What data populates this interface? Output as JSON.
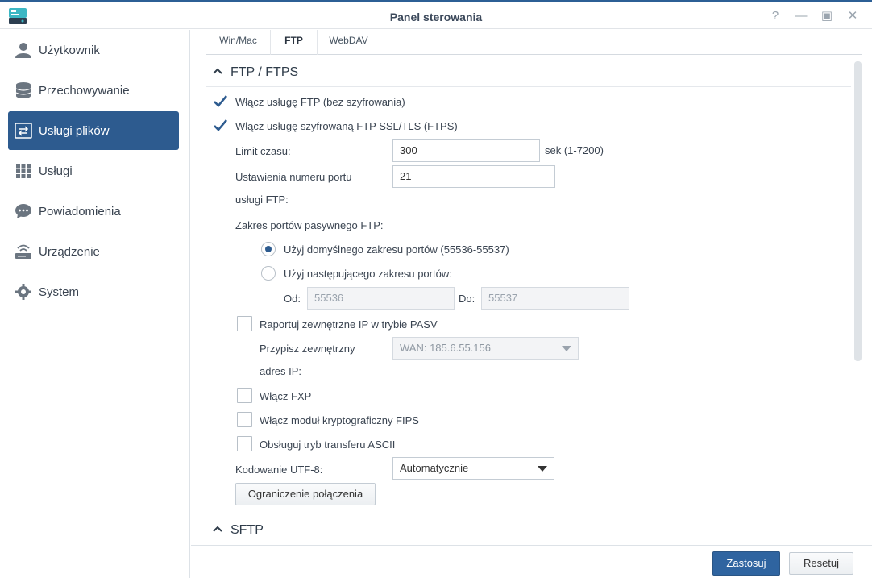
{
  "window": {
    "title": "Panel sterowania",
    "help_glyph": "?",
    "minimize_glyph": "—",
    "maximize_glyph": "▣",
    "close_glyph": "✕"
  },
  "sidebar": {
    "items": [
      {
        "label": "Użytkownik",
        "icon": "user-icon",
        "active": false
      },
      {
        "label": "Przechowywanie",
        "icon": "storage-icon",
        "active": false
      },
      {
        "label": "Usługi plików",
        "icon": "file-services-icon",
        "active": true
      },
      {
        "label": "Usługi",
        "icon": "grid-icon",
        "active": false
      },
      {
        "label": "Powiadomienia",
        "icon": "chat-icon",
        "active": false
      },
      {
        "label": "Urządzenie",
        "icon": "router-icon",
        "active": false
      },
      {
        "label": "System",
        "icon": "gear-icon",
        "active": false
      }
    ]
  },
  "tabs": [
    {
      "label": "Win/Mac",
      "active": false
    },
    {
      "label": "FTP",
      "active": true
    },
    {
      "label": "WebDAV",
      "active": false
    }
  ],
  "ftp_section": {
    "title": "FTP / FTPS",
    "enable_ftp": {
      "label": "Włącz usługę FTP (bez szyfrowania)",
      "checked": true
    },
    "enable_ftps": {
      "label": "Włącz usługę szyfrowaną FTP SSL/TLS (FTPS)",
      "checked": true
    },
    "timeout": {
      "label": "Limit czasu:",
      "value": "300",
      "suffix": "sek (1-7200)"
    },
    "port": {
      "label_line1": "Ustawienia numeru portu",
      "label_line2": "usługi FTP:",
      "value": "21"
    },
    "passive_range": {
      "label": "Zakres portów pasywnego FTP:",
      "default_option": {
        "label": "Użyj domyślnego zakresu portów (55536-55537)",
        "selected": true
      },
      "custom_option": {
        "label": "Użyj następującego zakresu portów:",
        "selected": false
      },
      "from_label": "Od:",
      "from_placeholder": "55536",
      "to_label": "Do:",
      "to_placeholder": "55537"
    },
    "report_external_ip": {
      "label": "Raportuj zewnętrzne IP w trybie PASV",
      "checked": false
    },
    "assign_external": {
      "label_line1": "Przypisz zewnętrzny",
      "label_line2": "adres IP:",
      "value": "WAN: 185.6.55.156"
    },
    "enable_fxp": {
      "label": "Włącz FXP",
      "checked": false
    },
    "enable_fips": {
      "label": "Włącz moduł kryptograficzny FIPS",
      "checked": false
    },
    "ascii_mode": {
      "label": "Obsługuj tryb transferu ASCII",
      "checked": false
    },
    "utf8": {
      "label": "Kodowanie UTF-8:",
      "value": "Automatycznie"
    },
    "connection_limit_button": "Ograniczenie połączenia"
  },
  "sftp_section": {
    "title": "SFTP"
  },
  "footer": {
    "apply_label": "Zastosuj",
    "reset_label": "Resetuj"
  },
  "colors": {
    "accent": "#2d5b8f",
    "primary_button": "#2f64a0",
    "topline": "#2c5f95"
  }
}
